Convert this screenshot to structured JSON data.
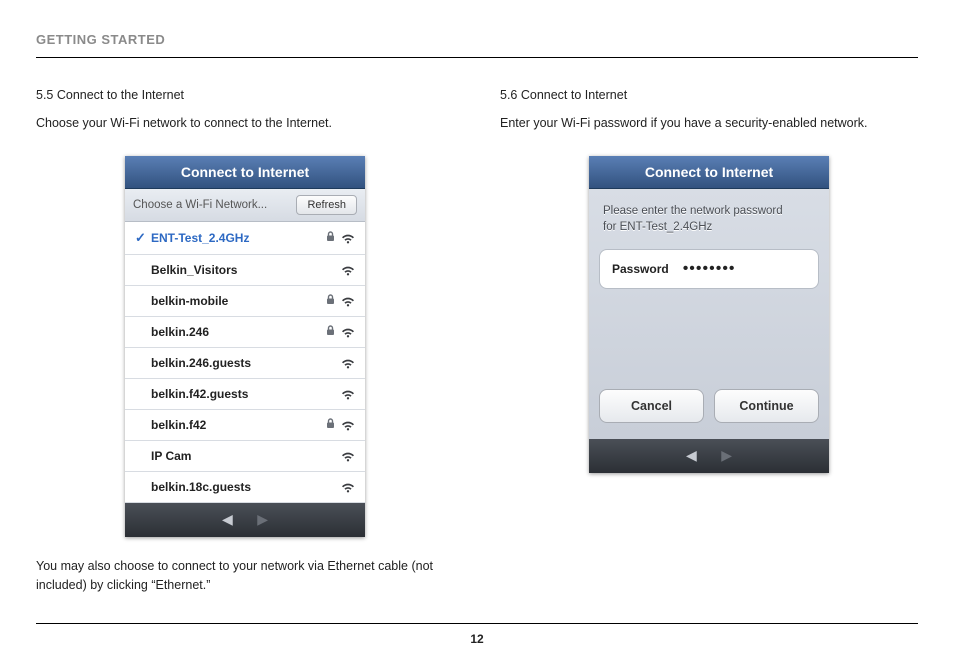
{
  "section_title": "GETTING STARTED",
  "page_number": "12",
  "left": {
    "step_title": "5.5 Connect to the Internet",
    "step_desc": "Choose your Wi-Fi network to connect to the Internet.",
    "footnote": "You may also choose to connect to your network via Ethernet cable (not included) by clicking “Ethernet.”",
    "screen_title": "Connect to Internet",
    "choose_label": "Choose a Wi-Fi Network...",
    "refresh_label": "Refresh",
    "networks": [
      {
        "name": "ENT-Test_2.4GHz",
        "locked": true,
        "selected": true
      },
      {
        "name": "Belkin_Visitors",
        "locked": false,
        "selected": false
      },
      {
        "name": "belkin-mobile",
        "locked": true,
        "selected": false
      },
      {
        "name": "belkin.246",
        "locked": true,
        "selected": false
      },
      {
        "name": "belkin.246.guests",
        "locked": false,
        "selected": false
      },
      {
        "name": "belkin.f42.guests",
        "locked": false,
        "selected": false
      },
      {
        "name": "belkin.f42",
        "locked": true,
        "selected": false
      },
      {
        "name": "IP Cam",
        "locked": false,
        "selected": false
      },
      {
        "name": "belkin.18c.guests",
        "locked": false,
        "selected": false
      }
    ]
  },
  "right": {
    "step_title": "5.6 Connect to Internet",
    "step_desc": "Enter your Wi-Fi password if you have a security-enabled network.",
    "screen_title": "Connect to Internet",
    "prompt_line1": "Please enter the network password",
    "prompt_line2": "for ENT-Test_2.4GHz",
    "password_label": "Password",
    "password_value": "••••••••",
    "cancel_label": "Cancel",
    "continue_label": "Continue"
  }
}
